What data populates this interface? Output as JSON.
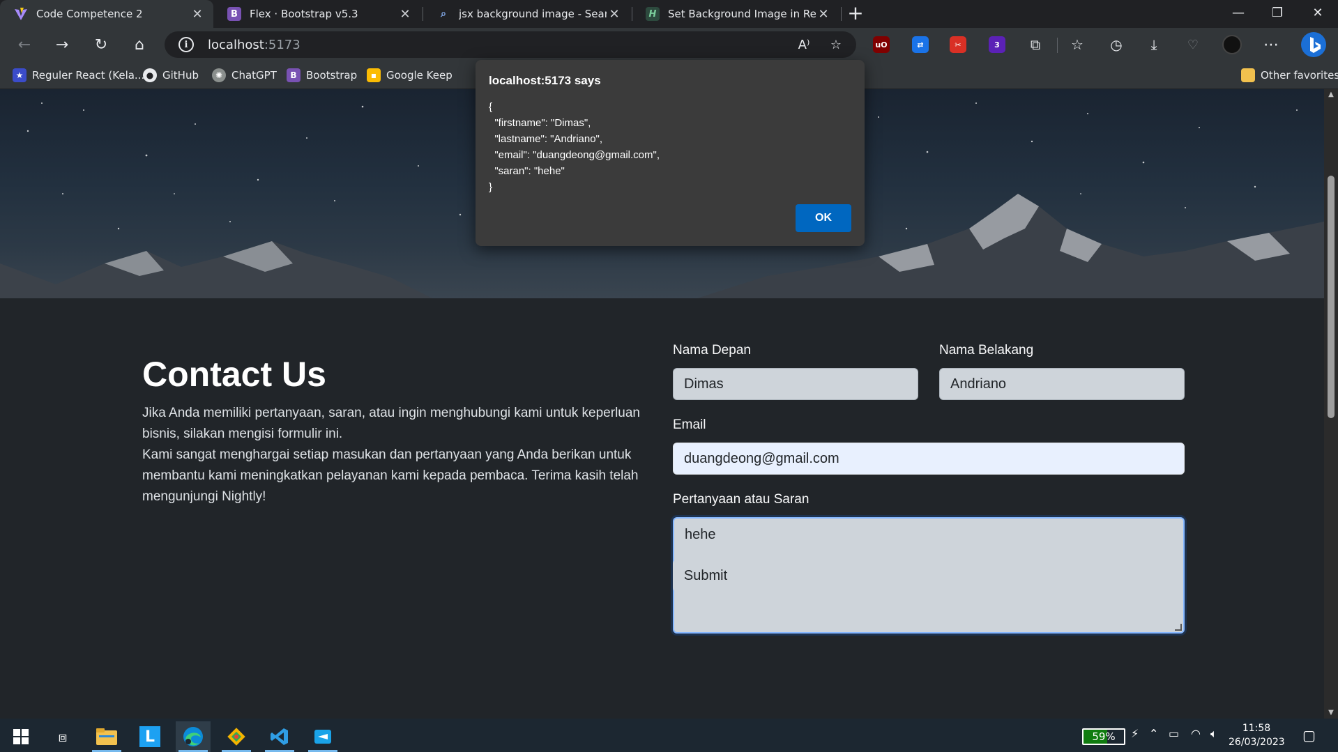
{
  "browser": {
    "tabs": [
      {
        "title": "Code Competence 2",
        "icon": "vite-logo-icon",
        "active": true
      },
      {
        "title": "Flex · Bootstrap v5.3",
        "icon": "bootstrap-icon",
        "active": false
      },
      {
        "title": "jsx background image - Search",
        "icon": "search-icon",
        "active": false
      },
      {
        "title": "Set Background Image in React.js",
        "icon": "site-icon",
        "active": false
      }
    ],
    "url_host": "localhost",
    "url_port": ":5173",
    "bookmarks": [
      {
        "label": "Reguler React (Kela...",
        "icon": "bookmark-icon"
      },
      {
        "label": "GitHub",
        "icon": "github-icon"
      },
      {
        "label": "ChatGPT",
        "icon": "chatgpt-icon"
      },
      {
        "label": "Bootstrap",
        "icon": "bootstrap-icon"
      },
      {
        "label": "Google Keep",
        "icon": "keep-icon"
      }
    ],
    "other_favorites": "Other favorites"
  },
  "page": {
    "contact": {
      "title": "Contact Us",
      "paragraph1": "Jika Anda memiliki pertanyaan, saran, atau ingin menghubungi kami untuk keperluan bisnis, silakan mengisi formulir ini.",
      "paragraph2": "Kami sangat menghargai setiap masukan dan pertanyaan yang Anda berikan untuk membantu kami meningkatkan pelayanan kami kepada pembaca. Terima kasih telah mengunjungi Nightly!"
    },
    "form": {
      "firstname_label": "Nama Depan",
      "firstname_value": "Dimas",
      "lastname_label": "Nama Belakang",
      "lastname_value": "Andriano",
      "email_label": "Email",
      "email_value": "duangdeong@gmail.com",
      "message_label": "Pertanyaan atau Saran",
      "message_value": "hehe",
      "submit_label": "Submit"
    }
  },
  "dialog": {
    "title": "localhost:5173 says",
    "message": "{\n  \"firstname\": \"Dimas\",\n  \"lastname\": \"Andriano\",\n  \"email\": \"duangdeong@gmail.com\",\n  \"saran\": \"hehe\"\n}",
    "ok_label": "OK"
  },
  "taskbar": {
    "battery": "59%",
    "time": "11:58",
    "date": "26/03/2023",
    "apps": [
      "windows-start-icon",
      "task-view-icon",
      "file-explorer-icon",
      "l-app-icon",
      "edge-icon",
      "git-icon",
      "vscode-icon",
      "sync-app-icon"
    ]
  },
  "colors": {
    "page_bg": "#212529",
    "dialog_bg": "#3b3b3b",
    "ok_button": "#0067c0",
    "input_bg": "#ced4da"
  }
}
